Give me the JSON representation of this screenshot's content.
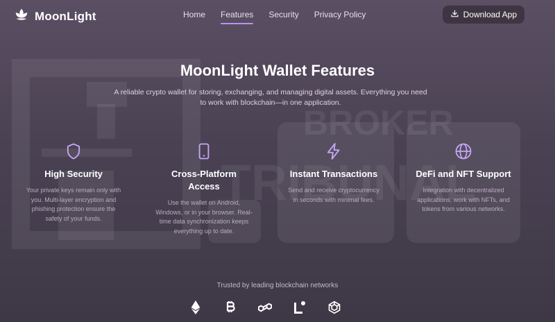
{
  "brand": {
    "name": "MoonLight",
    "logo_icon": "lotus-icon"
  },
  "nav": {
    "links": [
      {
        "label": "Home",
        "active": false
      },
      {
        "label": "Features",
        "active": true
      },
      {
        "label": "Security",
        "active": false
      },
      {
        "label": "Privacy Policy",
        "active": false
      }
    ],
    "download": {
      "label": "Download App",
      "icon": "download-icon"
    }
  },
  "hero": {
    "title": "MoonLight Wallet Features",
    "subtitle": "A reliable crypto wallet for storing, exchanging, and managing digital assets. Everything you need to work with blockchain—in one application."
  },
  "features": [
    {
      "icon": "shield-icon",
      "title": "High Security",
      "desc": "Your private keys remain only with you. Multi-layer encryption and phishing protection ensure the safety of your funds."
    },
    {
      "icon": "smartphone-icon",
      "title": "Cross-Platform Access",
      "desc": "Use the wallet on Android, Windows, or in your browser. Real-time data synchronization keeps everything up to date."
    },
    {
      "icon": "lightning-icon",
      "title": "Instant Transactions",
      "desc": "Send and receive cryptocurrency in seconds with minimal fees."
    },
    {
      "icon": "globe-icon",
      "title": "DeFi and NFT Support",
      "desc": "Integration with decentralized applications, work with NFTs, and tokens from various networks."
    }
  ],
  "trusted": {
    "label": "Trusted by leading blockchain networks",
    "logos": [
      "ethereum-icon",
      "bitcoin-icon",
      "polygon-icon",
      "linea-icon",
      "bnb-icon"
    ]
  },
  "watermark": {
    "line1": "BROKER",
    "line2": "TRIBUNAL"
  },
  "colors": {
    "accent": "#b794f6",
    "background": "#4a4253",
    "button": "#3d3542"
  }
}
